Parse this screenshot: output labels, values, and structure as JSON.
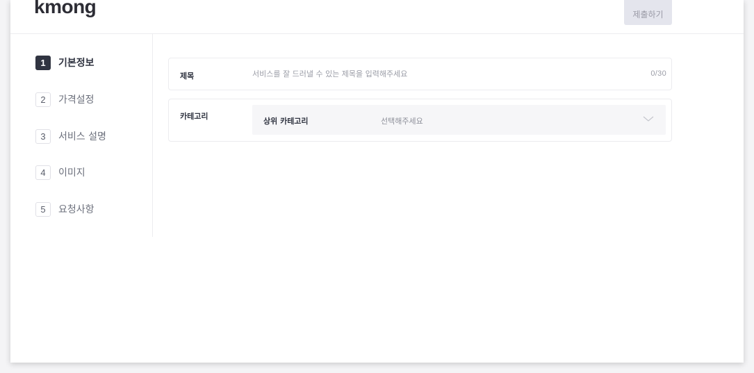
{
  "header": {
    "logo": "kmong",
    "submit_label": "제출하기"
  },
  "sidebar": {
    "steps": [
      {
        "num": "1",
        "label": "기본정보",
        "active": true
      },
      {
        "num": "2",
        "label": "가격설정",
        "active": false
      },
      {
        "num": "3",
        "label": "서비스 설명",
        "active": false
      },
      {
        "num": "4",
        "label": "이미지",
        "active": false
      },
      {
        "num": "5",
        "label": "요청사항",
        "active": false
      }
    ]
  },
  "form": {
    "title": {
      "label": "제목",
      "value": "",
      "placeholder": "서비스를 잘 드러낼 수 있는 제목을 입력해주세요",
      "counter": "0/30"
    },
    "category": {
      "label": "카테고리",
      "select_label": "상위 카테고리",
      "select_value": "선택해주세요",
      "icon": "chevron-down-icon"
    }
  },
  "colors": {
    "active_step": "#303441",
    "submit_bg": "#e4e5ed",
    "select_bg": "#f6f6f8"
  }
}
